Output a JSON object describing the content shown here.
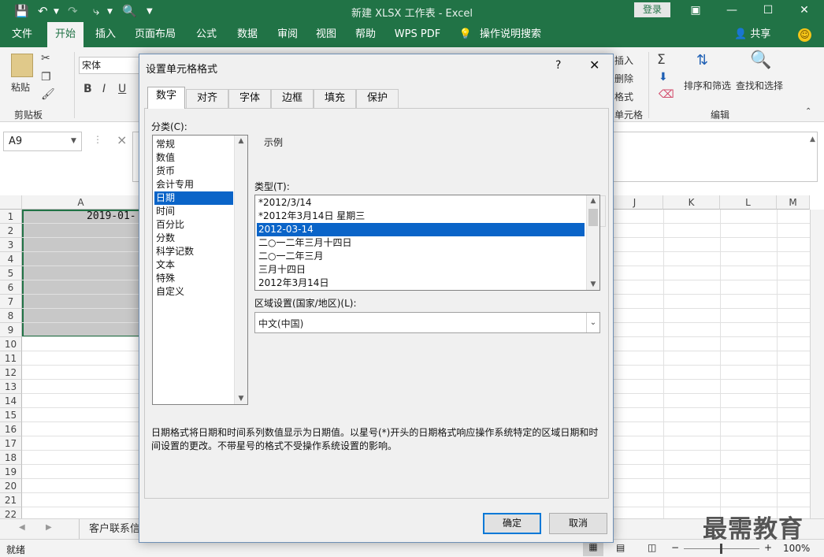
{
  "window": {
    "title": "新建 XLSX 工作表  -  Excel",
    "login": "登录"
  },
  "tabs": [
    "文件",
    "开始",
    "插入",
    "页面布局",
    "公式",
    "数据",
    "审阅",
    "视图",
    "帮助",
    "WPS PDF",
    "操作说明搜索"
  ],
  "share": "共享",
  "ribbon": {
    "paste": "粘贴",
    "clipboard": "剪贴板",
    "font_name": "宋体",
    "bold": "B",
    "italic": "I",
    "underline": "U",
    "insert": "插入",
    "delete": "删除",
    "format": "格式",
    "cells": "单元格",
    "sort_filter": "排序和筛选",
    "find_select": "查找和选择",
    "editing": "编辑"
  },
  "formula_bar": {
    "name_box": "A9",
    "cancel_icon": "×"
  },
  "grid": {
    "columns": [
      "A",
      "J",
      "K",
      "L",
      "M"
    ],
    "rows": [
      "1",
      "2",
      "3",
      "4",
      "5",
      "6",
      "7",
      "8",
      "9",
      "10",
      "11",
      "12",
      "13",
      "14",
      "15",
      "16",
      "17",
      "18",
      "19",
      "20",
      "21",
      "22"
    ],
    "cell_a1": "2019-01-"
  },
  "sheet_tab": "客户联系信",
  "status": {
    "ready": "就绪",
    "zoom": "100%"
  },
  "watermark": "最需教育",
  "dialog": {
    "title": "设置单元格格式",
    "help": "?",
    "close": "✕",
    "tabs": [
      "数字",
      "对齐",
      "字体",
      "边框",
      "填充",
      "保护"
    ],
    "category_label": "分类(C):",
    "categories": [
      "常规",
      "数值",
      "货币",
      "会计专用",
      "日期",
      "时间",
      "百分比",
      "分数",
      "科学记数",
      "文本",
      "特殊",
      "自定义"
    ],
    "selected_category": "日期",
    "sample_label": "示例",
    "type_label": "类型(T):",
    "types": [
      "*2012/3/14",
      "*2012年3月14日 星期三",
      "2012-03-14",
      "二○一二年三月十四日",
      "二○一二年三月",
      "三月十四日",
      "2012年3月14日"
    ],
    "selected_type": "2012-03-14",
    "locale_label": "区域设置(国家/地区)(L):",
    "locale_value": "中文(中国)",
    "description": "日期格式将日期和时间系列数值显示为日期值。以星号(*)开头的日期格式响应操作系统特定的区域日期和时间设置的更改。不带星号的格式不受操作系统设置的影响。",
    "ok": "确定",
    "cancel": "取消"
  }
}
